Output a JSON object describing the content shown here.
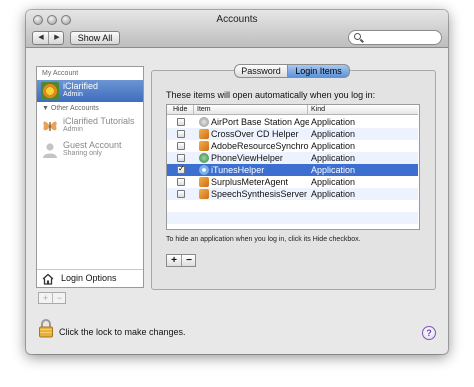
{
  "window": {
    "title": "Accounts"
  },
  "toolbar": {
    "back_glyph": "◀",
    "forward_glyph": "▶",
    "show_all_label": "Show All",
    "search_placeholder": ""
  },
  "sidebar": {
    "my_account_label": "My Account",
    "other_accounts_label": "▼ Other Accounts",
    "accounts": [
      {
        "name": "iClarified",
        "role": "Admin",
        "selected": true,
        "icon": "flower-avatar"
      },
      {
        "name": "iClarified Tutorials",
        "role": "Admin",
        "selected": false,
        "icon": "butterfly-avatar"
      },
      {
        "name": "Guest Account",
        "role": "Sharing only",
        "selected": false,
        "icon": "guest-silhouette-avatar"
      }
    ],
    "login_options_label": "Login Options",
    "add_glyph": "+",
    "remove_glyph": "−"
  },
  "tabs": [
    {
      "label": "Password",
      "active": false
    },
    {
      "label": "Login Items",
      "active": true
    }
  ],
  "login_items": {
    "intro": "These items will open automatically when you log in:",
    "columns": {
      "hide": "Hide",
      "item": "Item",
      "kind": "Kind"
    },
    "rows": [
      {
        "hide": false,
        "item": "AirPort Base Station Agent",
        "kind": "Application",
        "icon": "airport-icon"
      },
      {
        "hide": false,
        "item": "CrossOver CD Helper",
        "kind": "Application",
        "icon": "crossover-icon"
      },
      {
        "hide": false,
        "item": "AdobeResourceSynchroni",
        "kind": "Application",
        "icon": "adobe-icon"
      },
      {
        "hide": false,
        "item": "PhoneViewHelper",
        "kind": "Application",
        "icon": "phoneview-icon"
      },
      {
        "hide": true,
        "item": "iTunesHelper",
        "kind": "Application",
        "icon": "itunes-icon",
        "selected": true
      },
      {
        "hide": false,
        "item": "SurplusMeterAgent",
        "kind": "Application",
        "icon": "surplusmeter-icon"
      },
      {
        "hide": false,
        "item": "SpeechSynthesisServer",
        "kind": "Application",
        "icon": "speech-icon"
      }
    ],
    "hint": "To hide an application when you log in, click its Hide checkbox.",
    "add_glyph": "+",
    "remove_glyph": "−"
  },
  "footer": {
    "lock_text": "Click the lock to make changes.",
    "help_glyph": "?"
  },
  "colors": {
    "selection": "#3c6fd0",
    "sidebar_selection": "#3e6dbf",
    "alt_row": "#edf3fe",
    "help_purple": "#6a3fb0"
  }
}
